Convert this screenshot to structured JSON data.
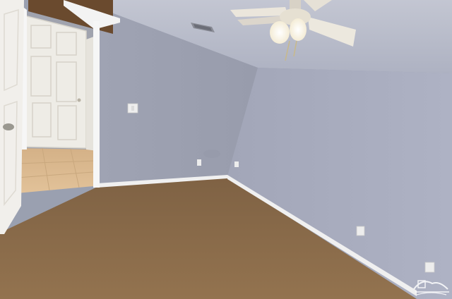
{
  "scene": {
    "description_free": true,
    "colors": {
      "left_wall": "#a4a8b8",
      "right_wall": "#a9adbf",
      "ceiling": "#b4b8c6",
      "carpet": "#8a6a4c",
      "trim": "#f2f2f2",
      "hall_floor": "#d9b98e",
      "door": "#f4f2ee"
    }
  },
  "watermark": {
    "visible_text": ""
  }
}
